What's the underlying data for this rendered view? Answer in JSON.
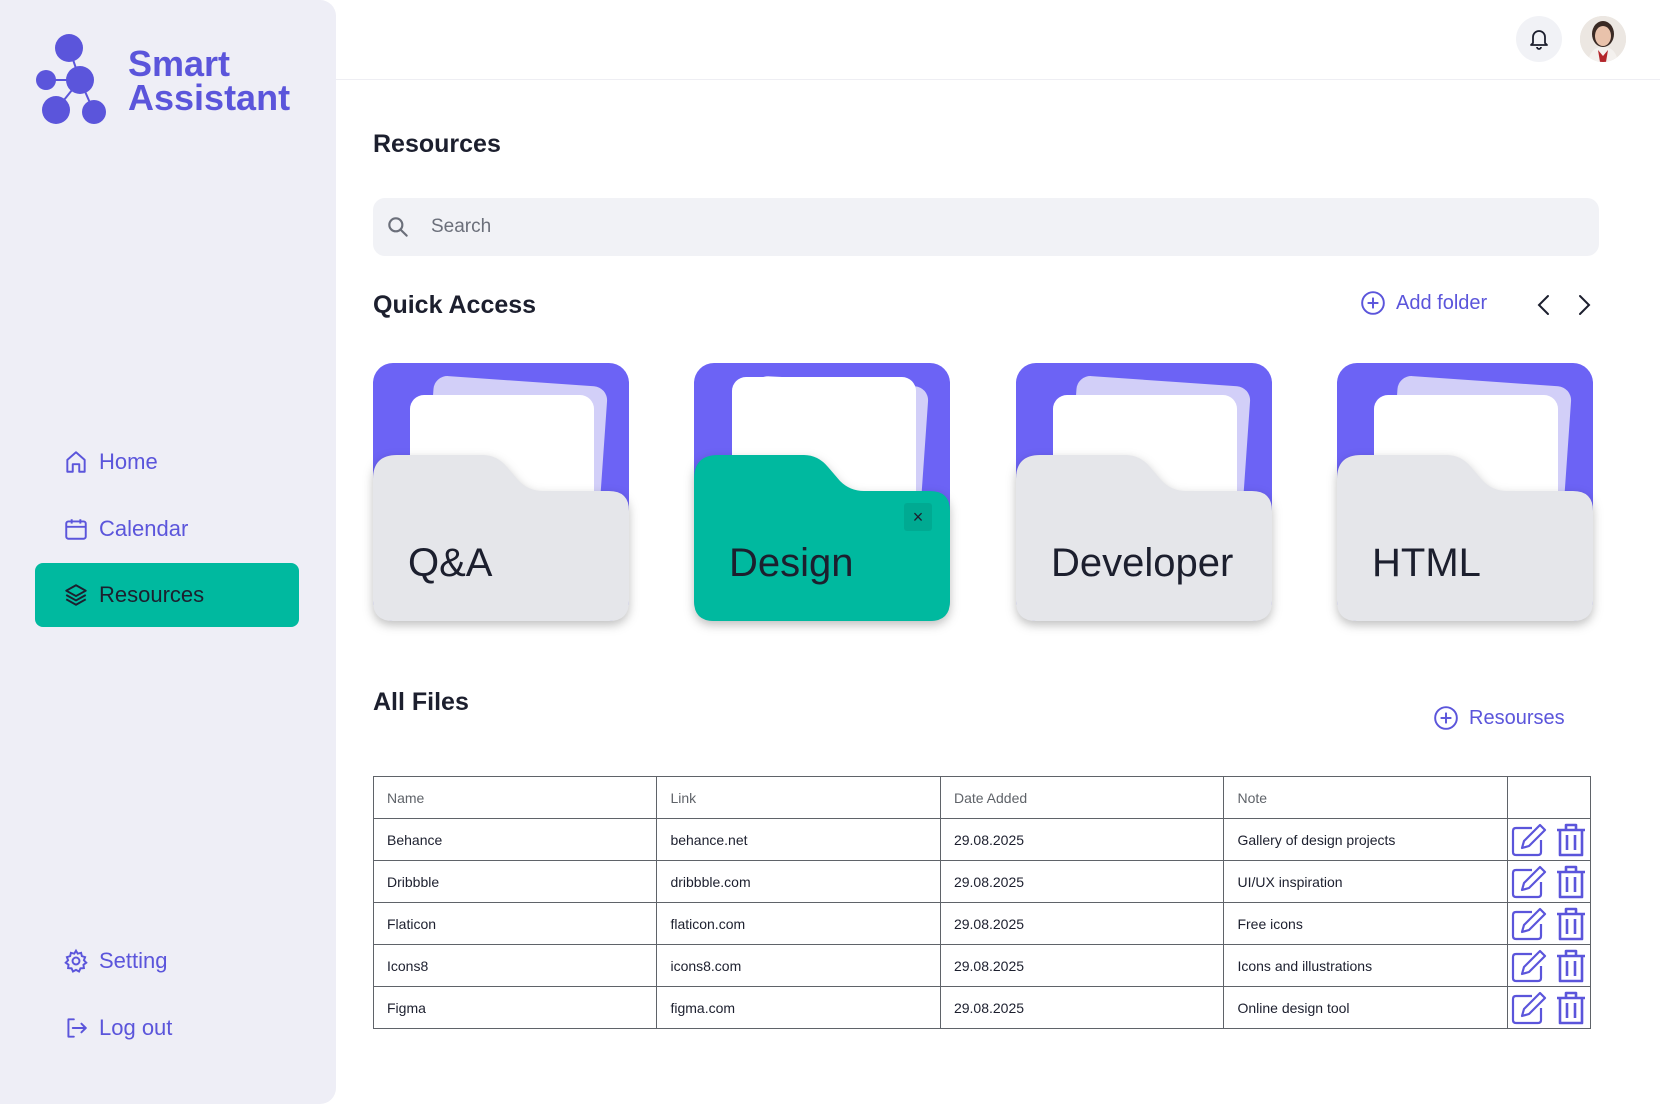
{
  "app": {
    "name_line1": "Smart",
    "name_line2": "Assistant",
    "accent_color": "#5b55db",
    "active_color": "#00b99f",
    "folder_color": "#6c63f5"
  },
  "sidebar": {
    "items": [
      {
        "label": "Home",
        "icon": "home-icon",
        "active": false
      },
      {
        "label": "Calendar",
        "icon": "calendar-icon",
        "active": false
      },
      {
        "label": "Resources",
        "icon": "layers-icon",
        "active": true
      }
    ],
    "bottom_items": [
      {
        "label": "Setting",
        "icon": "gear-icon"
      },
      {
        "label": "Log out",
        "icon": "logout-icon"
      }
    ]
  },
  "header": {
    "notification_icon": "bell-icon",
    "avatar_icon": "user-avatar"
  },
  "main": {
    "title": "Resources",
    "search": {
      "placeholder": "Search",
      "value": ""
    },
    "quick_access": {
      "title": "Quick Access",
      "add_folder_label": "Add folder",
      "folders": [
        {
          "label": "Q&A",
          "selected": false
        },
        {
          "label": "Design",
          "selected": true
        },
        {
          "label": "Developer",
          "selected": false
        },
        {
          "label": "HTML",
          "selected": false
        }
      ]
    },
    "all_files": {
      "title": "All Files",
      "add_label": "Resourses",
      "columns": [
        "Name",
        "Link",
        "Date Added",
        "Note",
        ""
      ],
      "rows": [
        {
          "name": "Behance",
          "link": "behance.net",
          "date": "29.08.2025",
          "note": "Gallery of design projects"
        },
        {
          "name": "Dribbble",
          "link": "dribbble.com",
          "date": "29.08.2025",
          "note": "UI/UX inspiration"
        },
        {
          "name": "Flaticon",
          "link": "flaticon.com",
          "date": "29.08.2025",
          "note": "Free icons"
        },
        {
          "name": "Icons8",
          "link": "icons8.com",
          "date": "29.08.2025",
          "note": "Icons and illustrations"
        },
        {
          "name": "Figma",
          "link": "figma.com",
          "date": "29.08.2025",
          "note": "Online design tool"
        }
      ]
    }
  }
}
